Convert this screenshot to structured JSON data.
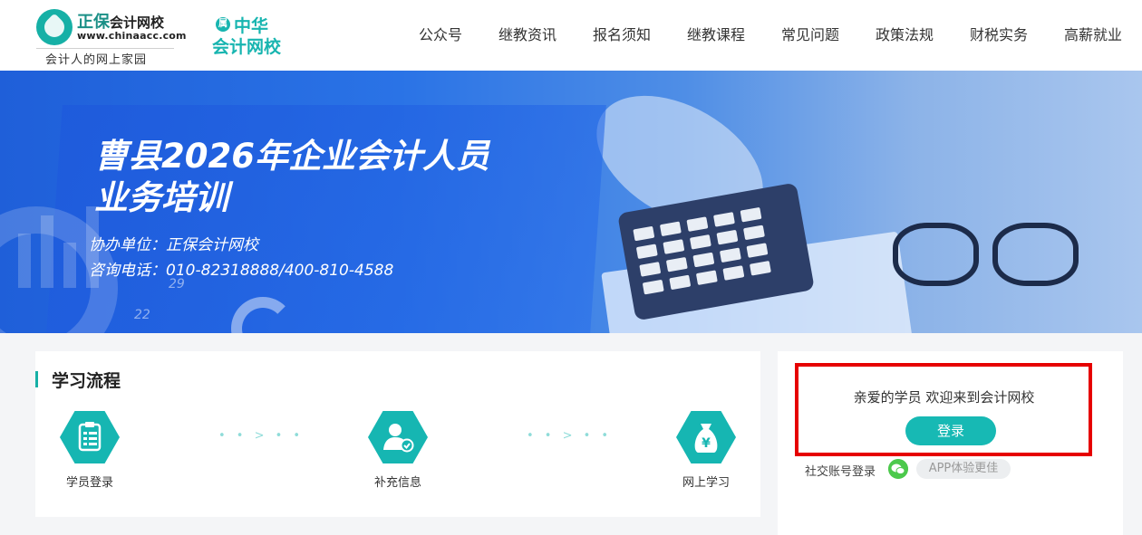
{
  "header": {
    "logo": {
      "brand": "正保",
      "brand_sub": "会计网校",
      "url": "www.chinaacc.com",
      "slogan": "会计人的网上家园"
    },
    "logo2": {
      "badge": "属",
      "line1": "中华",
      "line2": "会计网校"
    },
    "nav": [
      "公众号",
      "继教资讯",
      "报名须知",
      "继教课程",
      "常见问题",
      "政策法规",
      "财税实务",
      "高薪就业"
    ]
  },
  "banner": {
    "title_line1": "曹县2026年企业会计人员",
    "title_line2": "业务培训",
    "organizer": "协办单位：正保会计网校",
    "hotline": "咨询电话：010-82318888/400-810-4588",
    "decor_numbers": [
      "29",
      "22"
    ]
  },
  "process": {
    "title": "学习流程",
    "steps": [
      {
        "label": "学员登录",
        "icon": "clipboard-icon"
      },
      {
        "label": "补充信息",
        "icon": "user-check-icon"
      },
      {
        "label": "网上学习",
        "icon": "money-bag-icon"
      }
    ],
    "connector": "• • > • •"
  },
  "login": {
    "welcome": "亲爱的学员 欢迎来到会计网校",
    "button": "登录",
    "social_label": "社交账号登录",
    "app_pill": "APP体验更佳",
    "highlight_color": "#e60000"
  },
  "colors": {
    "accent": "#17b9b4",
    "banner_blue": "#2a73e6"
  }
}
